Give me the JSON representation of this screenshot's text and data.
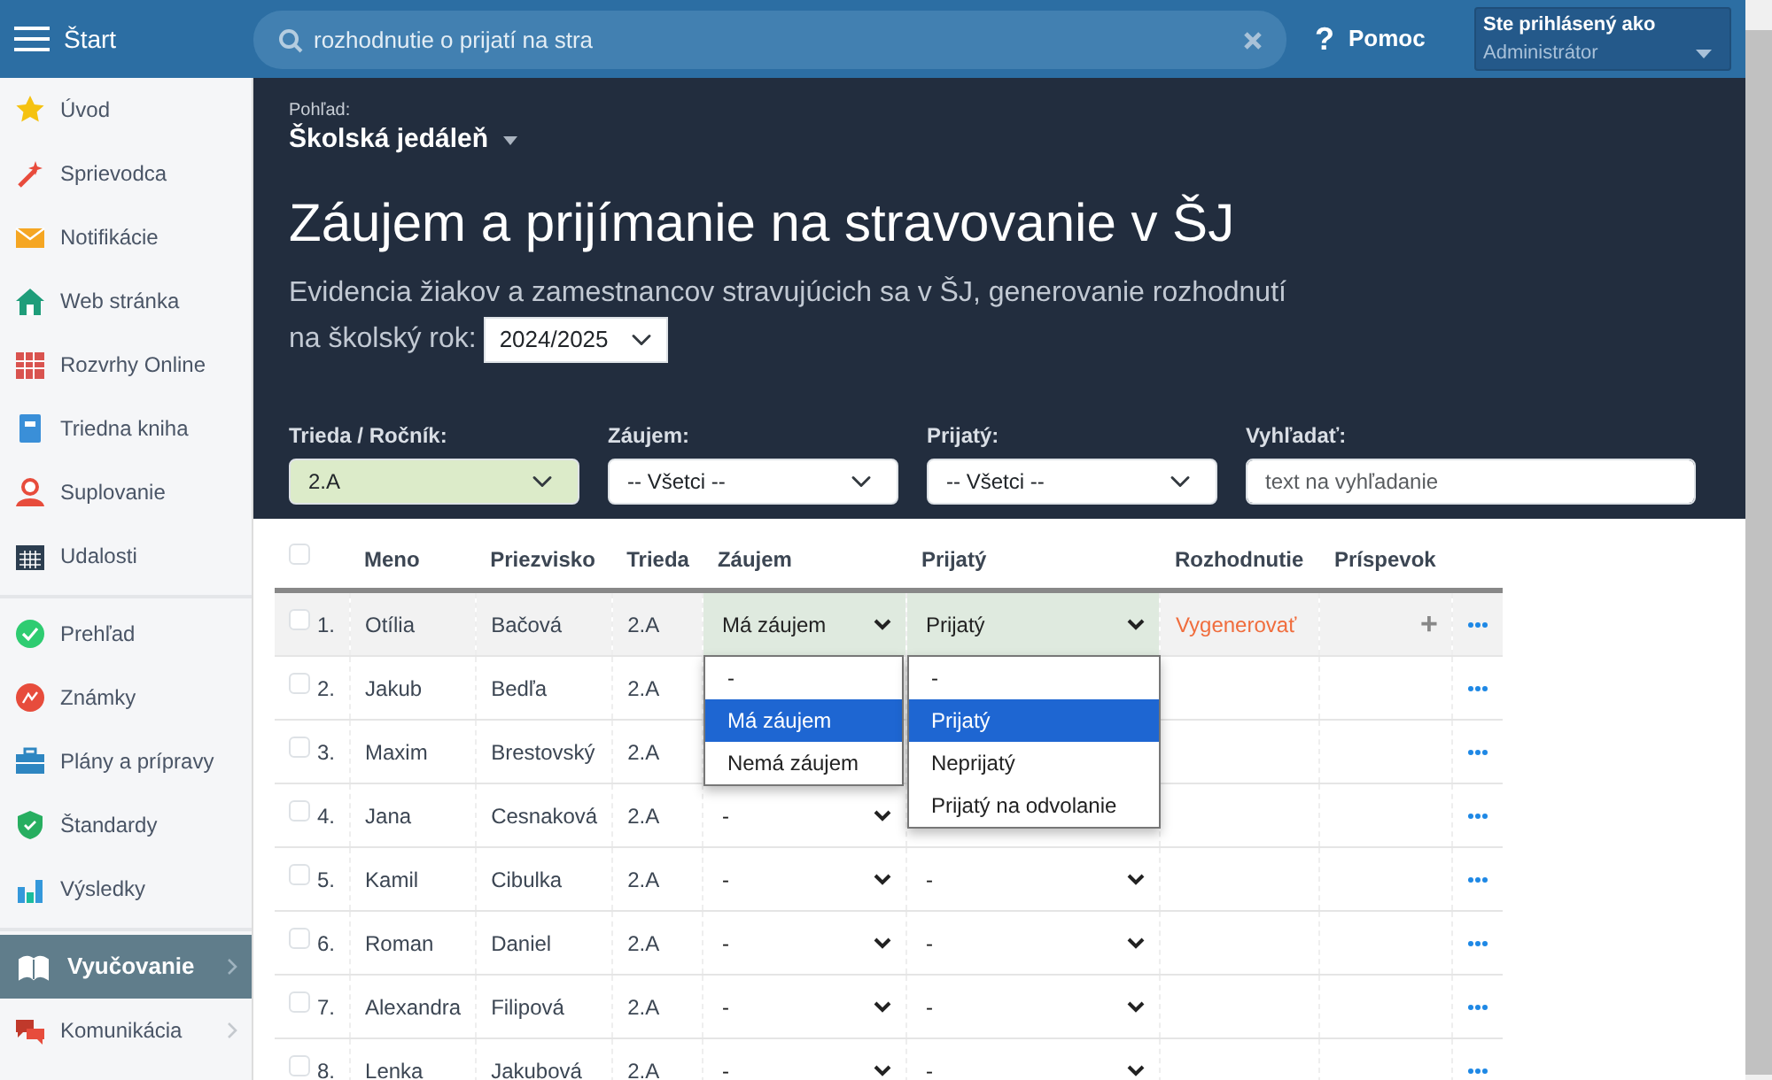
{
  "topbar": {
    "menu_label": "Štart",
    "search": {
      "value": "rozhodnutie o prijatí na stra"
    },
    "help_icon": "?",
    "help": "Pomoc",
    "user": {
      "caption": "Ste prihlásený ako",
      "role": "Administrátor"
    }
  },
  "sidebar": {
    "groups": [
      {
        "items": [
          {
            "label": "Úvod",
            "selected": false
          },
          {
            "label": "Sprievodca",
            "selected": false
          },
          {
            "label": "Notifikácie",
            "selected": false
          },
          {
            "label": "Web stránka",
            "selected": false
          },
          {
            "label": "Rozvrhy Online",
            "selected": false
          },
          {
            "label": "Triedna kniha",
            "selected": false
          },
          {
            "label": "Suplovanie",
            "selected": false
          },
          {
            "label": "Udalosti",
            "selected": false
          }
        ]
      },
      {
        "items": [
          {
            "label": "Prehľad",
            "selected": false
          },
          {
            "label": "Známky",
            "selected": false
          },
          {
            "label": "Plány a prípravy",
            "selected": false
          },
          {
            "label": "Štandardy",
            "selected": false
          },
          {
            "label": "Výsledky",
            "selected": false
          }
        ]
      },
      {
        "items": [
          {
            "label": "Vyučovanie",
            "selected": true,
            "submenu": true
          },
          {
            "label": "Komunikácia",
            "selected": false,
            "submenu": true
          }
        ]
      }
    ]
  },
  "header": {
    "view_label": "Pohľad:",
    "view": "Školská jedáleň",
    "title": "Záujem a prijímanie na stravovanie v ŠJ",
    "subtitle_line1": "Evidencia žiakov a zamestnancov stravujúcich sa v ŠJ, generovanie rozhodnutí",
    "subtitle_line2": "na školský rok:",
    "year": "2024/2025"
  },
  "filters": [
    {
      "kind": "select",
      "label": "Trieda / Ročník:",
      "value": "2.A",
      "active": true
    },
    {
      "kind": "select",
      "label": "Záujem:",
      "value": "-- Všetci --",
      "active": false
    },
    {
      "kind": "select",
      "label": "Prijatý:",
      "value": "-- Všetci --",
      "active": false
    },
    {
      "kind": "text",
      "label": "Vyhľadať:",
      "placeholder": "text na vyhľadanie",
      "active": false
    }
  ],
  "table": {
    "select_all_checked": false,
    "columns": [
      "Meno",
      "Priezvisko",
      "Trieda",
      "Záujem",
      "Prijatý",
      "Rozhodnutie",
      "Príspevok"
    ],
    "rows": [
      {
        "no": "1.",
        "checked": false,
        "hovered": true,
        "meno": "Otília",
        "priezvisko": "Bačová",
        "trieda": "2.A",
        "zaujem": "Má záujem",
        "prijaty": "Prijatý",
        "rozhodnutie": "Vygenerovať",
        "prispevok": "+",
        "zaujem_dropdown": [
          {
            "label": "-",
            "selected": false
          },
          {
            "label": "Má záujem",
            "selected": true
          },
          {
            "label": "Nemá záujem",
            "selected": false
          }
        ],
        "prijaty_dropdown": [
          {
            "label": "-",
            "selected": false
          },
          {
            "label": "Prijatý",
            "selected": true
          },
          {
            "label": "Neprijatý",
            "selected": false
          },
          {
            "label": "Prijatý na odvolanie",
            "selected": false
          }
        ]
      },
      {
        "no": "2.",
        "checked": false,
        "hovered": false,
        "meno": "Jakub",
        "priezvisko": "Bedľa",
        "trieda": "2.A"
      },
      {
        "no": "3.",
        "checked": false,
        "hovered": false,
        "meno": "Maxim",
        "priezvisko": "Brestovský",
        "trieda": "2.A"
      },
      {
        "no": "4.",
        "checked": false,
        "hovered": false,
        "meno": "Jana",
        "priezvisko": "Cesnaková",
        "trieda": "2.A",
        "zaujem": "-"
      },
      {
        "no": "5.",
        "checked": false,
        "hovered": false,
        "meno": "Kamil",
        "priezvisko": "Cibulka",
        "trieda": "2.A",
        "zaujem": "-",
        "prijaty": "-"
      },
      {
        "no": "6.",
        "checked": false,
        "hovered": false,
        "meno": "Roman",
        "priezvisko": "Daniel",
        "trieda": "2.A",
        "zaujem": "-",
        "prijaty": "-"
      },
      {
        "no": "7.",
        "checked": false,
        "hovered": false,
        "meno": "Alexandra",
        "priezvisko": "Filipová",
        "trieda": "2.A",
        "zaujem": "-",
        "prijaty": "-"
      },
      {
        "no": "8.",
        "checked": false,
        "hovered": false,
        "meno": "Lenka",
        "priezvisko": "Jakubová",
        "trieda": "2.A",
        "zaujem": "-",
        "prijaty": "-"
      }
    ]
  }
}
